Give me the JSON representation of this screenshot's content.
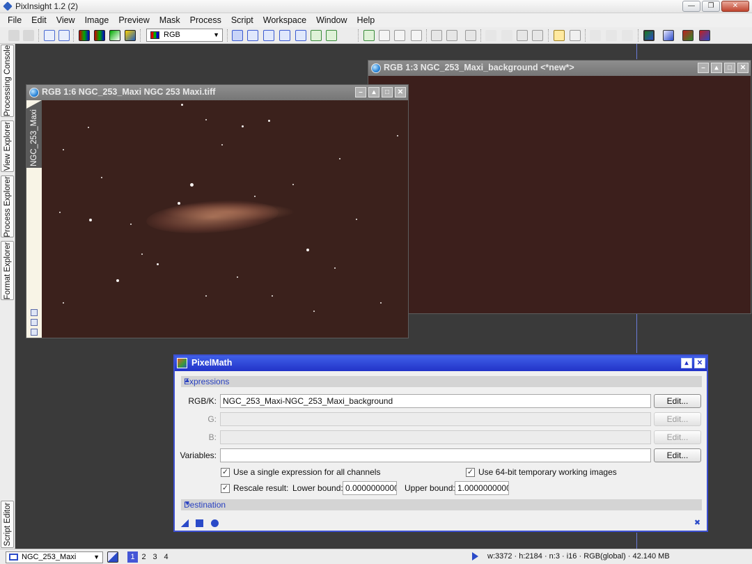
{
  "app": {
    "title": "PixInsight 1.2 (2)",
    "window_buttons": {
      "minimize": "—",
      "restore": "❐",
      "close": "✕"
    }
  },
  "menu": [
    "File",
    "Edit",
    "View",
    "Image",
    "Preview",
    "Mask",
    "Process",
    "Script",
    "Workspace",
    "Window",
    "Help"
  ],
  "toolbar": {
    "color_space": "RGB"
  },
  "sidebar": {
    "tabs": [
      "Processing Console",
      "View Explorer",
      "Process Explorer",
      "Format Explorer",
      "Script Editor"
    ]
  },
  "windows": [
    {
      "title": "RGB 1:6 NGC_253_Maxi NGC 253 Maxi.tiff",
      "view_id": "NGC_253_Maxi"
    },
    {
      "title": "RGB 1:3 NGC_253_Maxi_background <*new*>"
    }
  ],
  "pixelmath": {
    "title": "PixelMath",
    "expressions_section": "Expressions",
    "destination_section": "Destination",
    "rows": [
      {
        "label": "RGB/K:",
        "value": "NGC_253_Maxi-NGC_253_Maxi_background",
        "enabled": true,
        "button": "Edit..."
      },
      {
        "label": "G:",
        "value": "",
        "enabled": false,
        "button": "Edit..."
      },
      {
        "label": "B:",
        "value": "",
        "enabled": false,
        "button": "Edit..."
      },
      {
        "label": "Variables:",
        "value": "",
        "enabled": true,
        "button": "Edit..."
      }
    ],
    "single_expression": "Use a single expression for all channels",
    "use_64bit": "Use 64-bit temporary working images",
    "rescale": "Rescale result:",
    "lower_bound_label": "Lower bound:",
    "lower_bound": "0.0000000000",
    "upper_bound_label": "Upper bound:",
    "upper_bound": "1.0000000000",
    "check_mark": "✓"
  },
  "statusbar": {
    "current_view": "NGC_253_Maxi",
    "workspaces": [
      "1",
      "2",
      "3",
      "4"
    ],
    "active_workspace": "1",
    "info": "w:3372 · h:2184 · n:3 · i16 · RGB(global) · 42.140 MB"
  },
  "colors": {
    "dialog_title": "#2f44d8",
    "image_background": "#3b211c",
    "workspace": "#3a3a3a"
  }
}
